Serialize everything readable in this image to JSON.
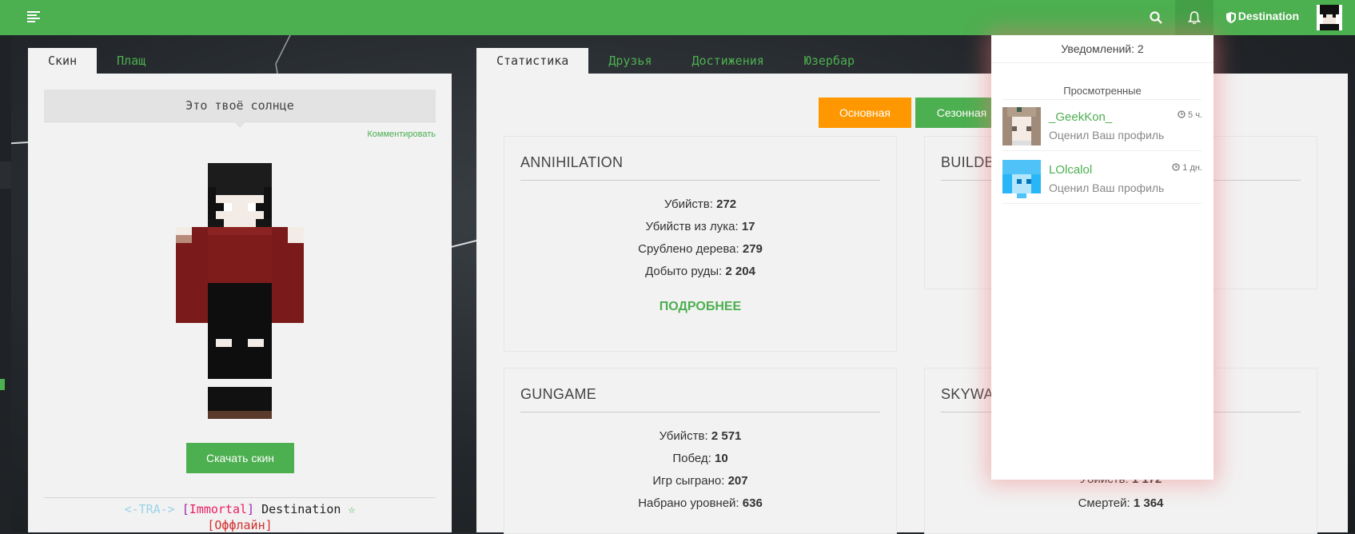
{
  "colors": {
    "accent": "#4caf50",
    "orange": "#ff9800",
    "panel": "#f2f2f2"
  },
  "topbar": {
    "username": "Destination",
    "icons": [
      "menu-icon",
      "search-icon",
      "bell-icon",
      "shield-icon"
    ]
  },
  "left_panel": {
    "tabs": [
      "Скин",
      "Плащ"
    ],
    "speech": "Это твоё солнце",
    "comment_label": "Комментировать",
    "download_label": "Скачать скин",
    "player": {
      "prefix": "<-TRA->",
      "rank_open": "[",
      "rank": "Immortal",
      "rank_close": "]",
      "name": "Destination",
      "star": "☆",
      "status": "[Оффлайн]"
    }
  },
  "right_panel": {
    "tabs": [
      "Статистика",
      "Друзья",
      "Достижения",
      "Юзербар"
    ],
    "buttons": {
      "main": "Основная",
      "season": "Сезонная"
    },
    "cards": [
      {
        "title": "ANNIHILATION",
        "stats": [
          {
            "label": "Убийств:",
            "value": "272"
          },
          {
            "label": "Убийств из лука:",
            "value": "17"
          },
          {
            "label": "Срублено дерева:",
            "value": "279"
          },
          {
            "label": "Добыто руды:",
            "value": "2 204"
          }
        ],
        "more": "ПОДРОБНЕЕ"
      },
      {
        "title": "BUILDB"
      },
      {
        "title": "GUNGAME",
        "stats": [
          {
            "label": "Убийств:",
            "value": "2 571"
          },
          {
            "label": "Побед:",
            "value": "10"
          },
          {
            "label": "Игр сыграно:",
            "value": "207"
          },
          {
            "label": "Набрано уровней:",
            "value": "636"
          }
        ]
      },
      {
        "title": "SKYWA",
        "stats": [
          {
            "label": "Убийств:",
            "value": "1 172"
          },
          {
            "label": "Смертей:",
            "value": "1 364"
          }
        ]
      }
    ]
  },
  "notifications": {
    "header": "Уведомлений: 2",
    "section": "Просмотренные",
    "items": [
      {
        "name": "_GeekKon_",
        "text": "Оценил Ваш профиль",
        "time": "5 ч."
      },
      {
        "name": "LOlcalol",
        "text": "Оценил Ваш профиль",
        "time": "1 дн."
      }
    ]
  }
}
